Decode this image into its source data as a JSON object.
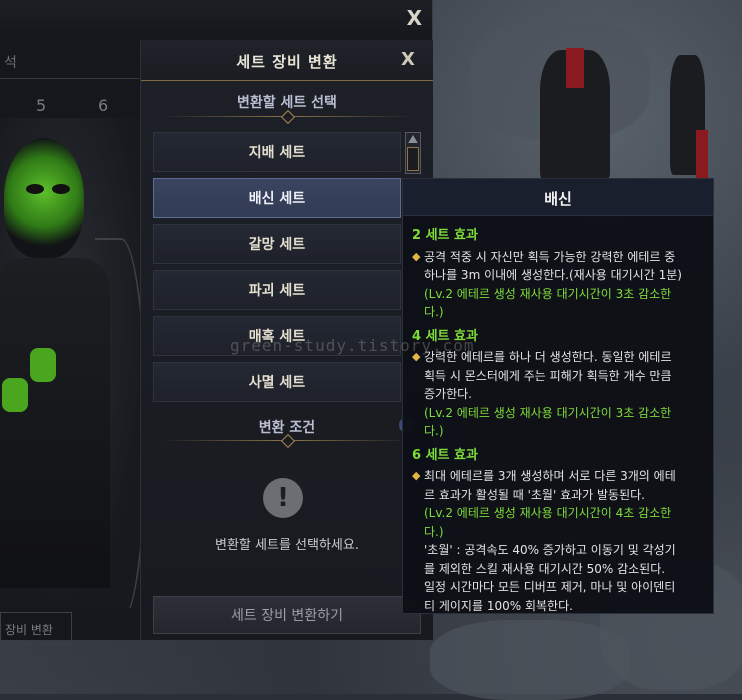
{
  "back_window": {
    "close_label": "X",
    "tab_partial": "석",
    "numbers": [
      "5",
      "6"
    ],
    "bottom_button": "장비 변환"
  },
  "dialog": {
    "title": "세트 장비 변환",
    "close_label": "X",
    "select_section_title": "변환할 세트 선택",
    "sets": [
      "지배 세트",
      "배신 세트",
      "갈망 세트",
      "파괴 세트",
      "매혹 세트",
      "사멸 세트"
    ],
    "selected_index": 1,
    "condition_section_title": "변환 조건",
    "warning_symbol": "!",
    "warning_text": "변환할 세트를 선택하세요.",
    "convert_button": "세트 장비 변환하기"
  },
  "tooltip": {
    "title": "배신",
    "effects": [
      {
        "heading": "2 세트 효과",
        "lines": [
          "공격 적중 시 자신만 획득 가능한 강력한 에테르 중",
          "하나를 3m 이내에 생성한다.(재사용 대기시간 1분)",
          "(Lv.2 에테르 생성 재사용 대기시간이 3초 감소한",
          "다.)"
        ]
      },
      {
        "heading": "4 세트 효과",
        "lines": [
          "강력한 에테르를 하나 더 생성한다. 동일한 에테르",
          "획득 시 몬스터에게 주는 피해가 획득한 개수 만큼",
          "증가한다.",
          "(Lv.2 에테르 생성 재사용 대기시간이 3초 감소한",
          "다.)"
        ]
      },
      {
        "heading": "6 세트 효과",
        "lines": [
          "최대 에테르를 3개 생성하며 서로 다른 3개의 에테",
          "르 효과가 활성될 때 '초월' 효과가 발동된다.",
          "(Lv.2 에테르 생성 재사용 대기시간이 4초 감소한",
          "다.)",
          "'초월' : 공격속도 40% 증가하고 이동기 및 각성기",
          "를 제외한 스킬 재사용 대기시간 50% 감소된다.",
          "일정 시간마다 모든 디버프 제거, 마나 및 아이덴티",
          "티 게이지를 100% 회복한다."
        ]
      }
    ]
  },
  "watermark": "green-study.tistory.com",
  "colors": {
    "effect_heading": "#7edc3a",
    "bullet": "#e2b546",
    "selected_item": "#3a4460"
  }
}
